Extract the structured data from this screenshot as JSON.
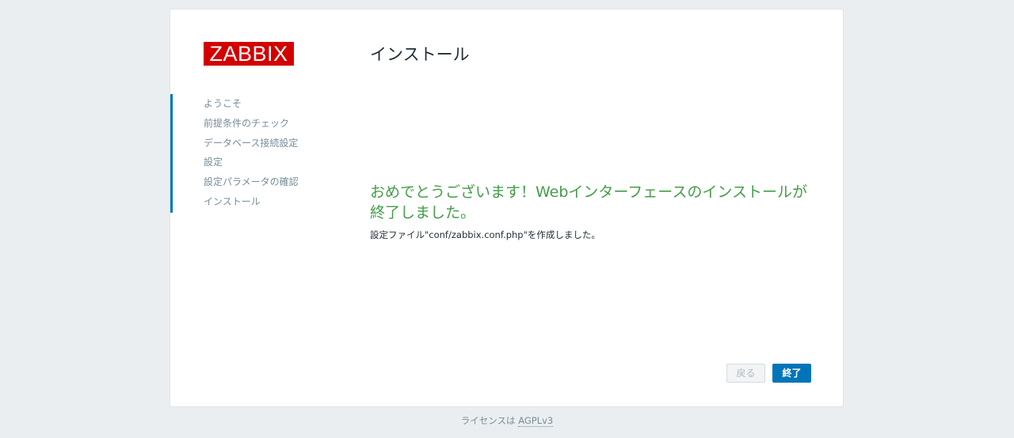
{
  "logo": {
    "text": "ZABBIX",
    "color": "#d40000"
  },
  "header": {
    "title": "インストール"
  },
  "sidebar": {
    "accent_color": "#0275b8",
    "steps": [
      {
        "label": "ようこそ"
      },
      {
        "label": "前提条件のチェック"
      },
      {
        "label": "データベース接続設定"
      },
      {
        "label": "設定"
      },
      {
        "label": "設定パラメータの確認"
      },
      {
        "label": "インストール"
      }
    ]
  },
  "main": {
    "success_message": "おめでとうございます！Webインターフェースのインストールが終了しました。",
    "success_color": "#429e47",
    "info_text": "設定ファイル\"conf/zabbix.conf.php\"を作成しました。"
  },
  "buttons": {
    "back_label": "戻る",
    "finish_label": "終了"
  },
  "footer": {
    "license_prefix": "ライセンスは ",
    "license_link": "AGPLv3"
  }
}
